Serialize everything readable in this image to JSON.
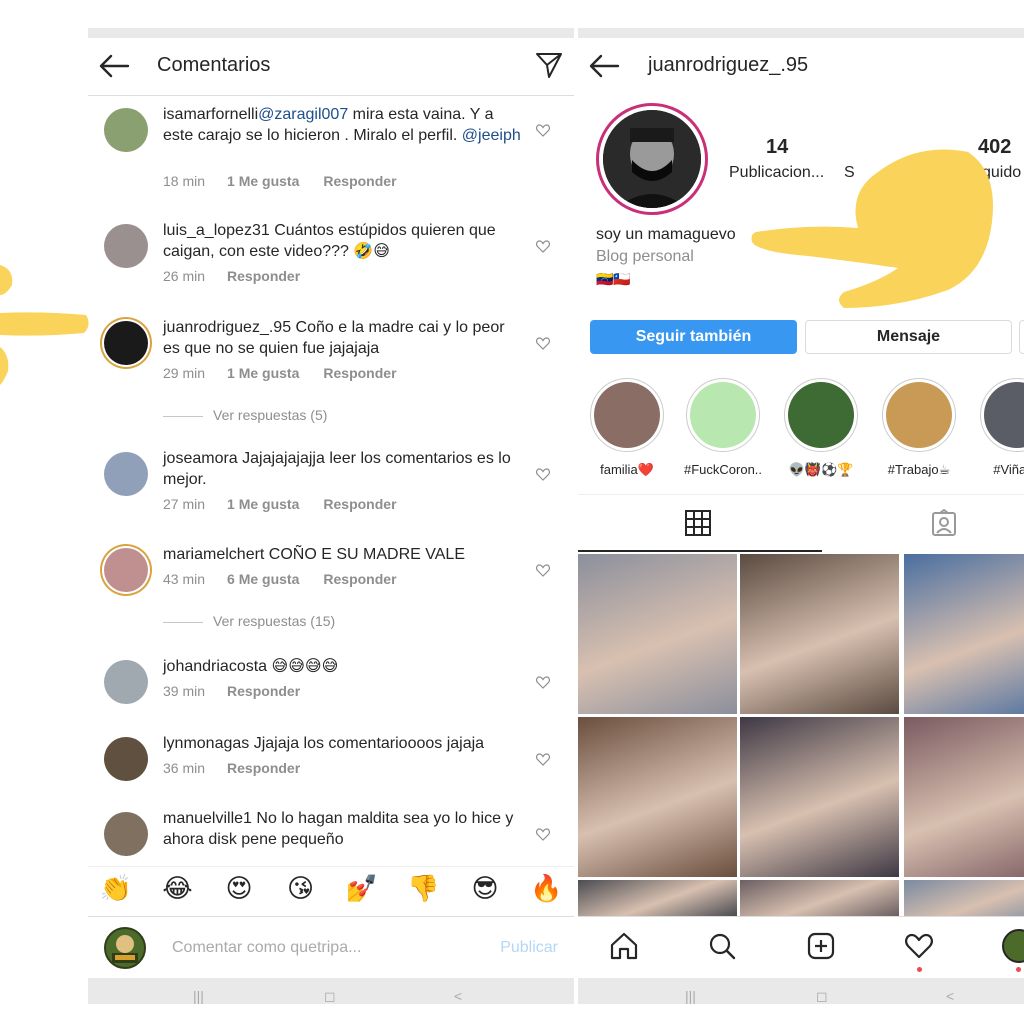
{
  "comments_screen": {
    "title": "Comentarios",
    "comments": [
      {
        "user": "isamarfornelli",
        "parts": [
          {
            "t": "mention",
            "v": "@zaragil007"
          },
          {
            "t": "text",
            "v": " mira esta vaina. Y a este carajo se lo hicieron . Miralo el perfil. "
          },
          {
            "t": "mention",
            "v": "@jeeiph"
          }
        ],
        "time": "18 min",
        "likes": "1 Me gusta",
        "reply": "Responder"
      },
      {
        "user": "luis_a_lopez31",
        "parts": [
          {
            "t": "text",
            "v": " Cuántos estúpidos quieren que caigan, con este video??? 🤣😅"
          }
        ],
        "time": "26 min",
        "likes": "",
        "reply": "Responder"
      },
      {
        "user": "juanrodriguez_.95",
        "parts": [
          {
            "t": "text",
            "v": " Coño e la madre cai y lo peor es que no se quien fue jajajaja"
          }
        ],
        "time": "29 min",
        "likes": "1 Me gusta",
        "reply": "Responder",
        "replies": "Ver respuestas (5)"
      },
      {
        "user": "joseamora",
        "parts": [
          {
            "t": "text",
            "v": " Jajajajajajja leer los comentarios es lo mejor."
          }
        ],
        "time": "27 min",
        "likes": "1 Me gusta",
        "reply": "Responder"
      },
      {
        "user": "mariamelchert",
        "parts": [
          {
            "t": "text",
            "v": " COÑO E SU MADRE VALE"
          }
        ],
        "time": "43 min",
        "likes": "6 Me gusta",
        "reply": "Responder",
        "replies": "Ver respuestas (15)"
      },
      {
        "user": "johandriacosta",
        "parts": [
          {
            "t": "text",
            "v": " 😅😅😅😅"
          }
        ],
        "time": "39 min",
        "likes": "",
        "reply": "Responder"
      },
      {
        "user": "lynmonagas",
        "parts": [
          {
            "t": "text",
            "v": " Jjajaja los comentarioooos jajaja"
          }
        ],
        "time": "36 min",
        "likes": "",
        "reply": "Responder"
      },
      {
        "user": "manuelville1",
        "parts": [
          {
            "t": "text",
            "v": " No lo hagan maldita sea yo lo hice y ahora disk pene pequeño"
          }
        ],
        "time": "",
        "likes": "",
        "reply": ""
      }
    ],
    "emojis": [
      "👏",
      "😂",
      "😍",
      "😘",
      "💅",
      "👎",
      "😎",
      "🔥"
    ],
    "input_placeholder": "Comentar como quetripa...",
    "publish_label": "Publicar",
    "nav_buttons": [
      "|||",
      "◻",
      "<"
    ]
  },
  "profile_screen": {
    "username": "juanrodriguez_.95",
    "stats": {
      "posts_num": "14",
      "posts_label": "Publicacion...",
      "followers_num": "",
      "followers_label": "S",
      "following_num": "402",
      "following_label": "guido"
    },
    "bio_name": "soy un mamaguevo",
    "bio_category": "Blog personal",
    "bio_flags": "🇻🇪🇨🇱",
    "follow_label": "Seguir también",
    "message_label": "Mensaje",
    "highlights": [
      {
        "label": "familia❤️",
        "color": "#8a6e66"
      },
      {
        "label": "#FuckCoron...",
        "color": "#b8e8b0"
      },
      {
        "label": "👽👹⚽🏆",
        "color": "#3e6a34"
      },
      {
        "label": "#Trabajo☕",
        "color": "#c89a56"
      },
      {
        "label": "#Viñade",
        "color": "#5a5c66"
      }
    ],
    "grid_colors": [
      "#8b8f9c",
      "#5a4a40",
      "#4a6ea0",
      "#6a4e3e",
      "#3e3844",
      "#7a5a60",
      "#4b4c52",
      "#6b5f62",
      "#7b8aa0"
    ]
  },
  "colors": {
    "accent_blue": "#3897f0",
    "overlay_yellow": "#f9d35a",
    "ring": "#c8317a"
  }
}
